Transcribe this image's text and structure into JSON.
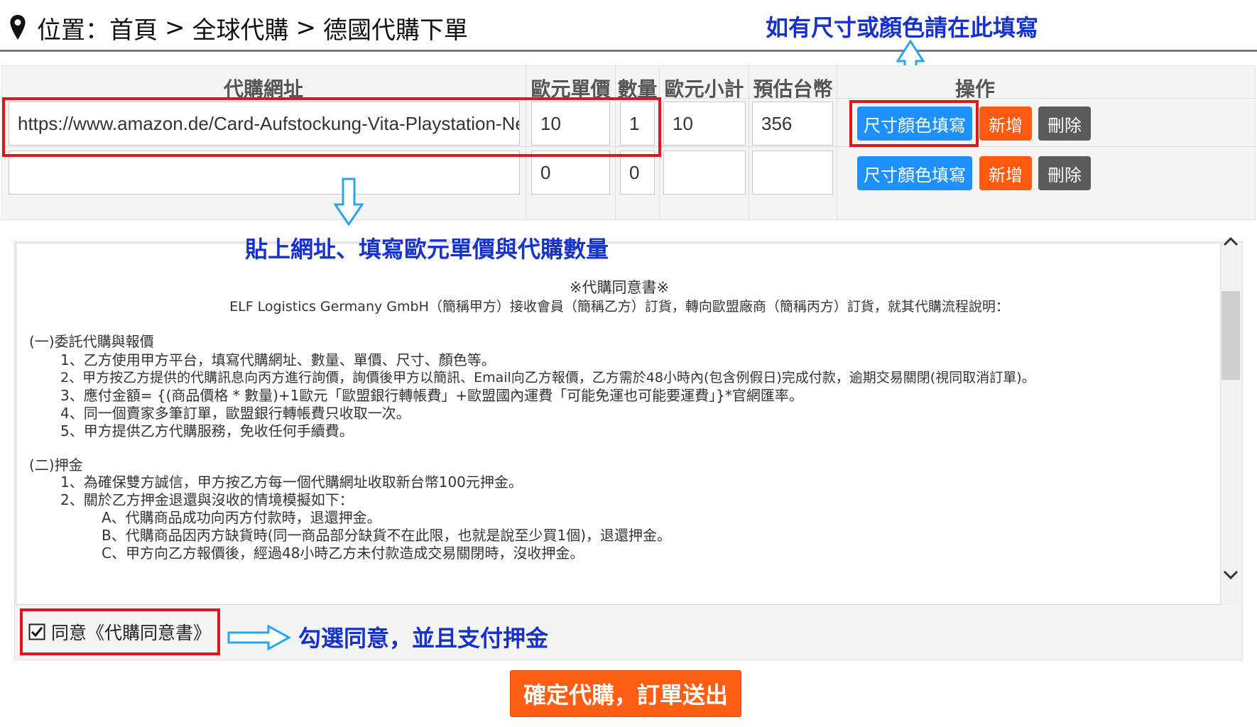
{
  "breadcrumb": {
    "label": "位置：",
    "items": [
      "首頁",
      "全球代購",
      "德國代購下單"
    ],
    "separator": ">"
  },
  "annotations": {
    "size_color": "如有尺寸或顏色請在此填寫",
    "paste_url": "貼上網址、填寫歐元單價與代購數量",
    "check_agree": "勾選同意，並且支付押金"
  },
  "table": {
    "headers": [
      "代購網址",
      "歐元單價",
      "數量",
      "歐元小計",
      "預估台幣",
      "操作"
    ],
    "rows": [
      {
        "url": "https://www.amazon.de/Card-Aufstockung-Vita-Playstation-Network-Download/dp",
        "price_eur": "10",
        "qty": "1",
        "subtotal_eur": "10",
        "est_twd": "356"
      },
      {
        "url": "",
        "price_eur": "0",
        "qty": "0",
        "subtotal_eur": "",
        "est_twd": ""
      }
    ],
    "buttons": {
      "size_color": "尺寸顏色填寫",
      "add": "新增",
      "delete": "刪除"
    }
  },
  "agreement": {
    "title": "※代購同意書※",
    "intro": "ELF Logistics Germany GmbH（簡稱甲方）接收會員（簡稱乙方）訂貨，轉向歐盟廠商（簡稱丙方）訂貨，就其代購流程說明：",
    "sections": [
      {
        "heading": "(一)委託代購與報價",
        "items": [
          "1、乙方使用甲方平台，填寫代購網址、數量、單價、尺寸、顏色等。",
          "2、甲方按乙方提供的代購訊息向丙方進行詢價，詢價後甲方以簡訊、Email向乙方報價，乙方需於48小時內(包含例假日)完成付款，逾期交易關閉(視同取消訂單)。",
          "3、應付金額= {(商品價格 * 數量)+1歐元「歐盟銀行轉帳費」+歐盟國內運費「可能免運也可能要運費」}*官網匯率。",
          "4、同一個賣家多筆訂單，歐盟銀行轉帳費只收取一次。",
          "5、甲方提供乙方代購服務，免收任何手續費。"
        ]
      },
      {
        "heading": "(二)押金",
        "items": [
          "1、為確保雙方誠信，甲方按乙方每一個代購網址收取新台幣100元押金。",
          "2、關於乙方押金退還與沒收的情境模擬如下："
        ],
        "subitems": [
          "A、代購商品成功向丙方付款時，退還押金。",
          "B、代購商品因丙方缺貨時(同一商品部分缺貨不在此限，也就是說至少買1個)，退還押金。",
          "C、甲方向乙方報價後，經過48小時乙方未付款造成交易關閉時，沒收押金。"
        ]
      }
    ],
    "checkbox_label": "同意《代購同意書》",
    "checked": true
  },
  "submit_label": "確定代購，訂單送出",
  "colors": {
    "accent_blue": "#1e90ff",
    "accent_orange": "#ff5a0f",
    "highlight_red": "#e0161e",
    "annotation_blue": "#1632c8"
  }
}
